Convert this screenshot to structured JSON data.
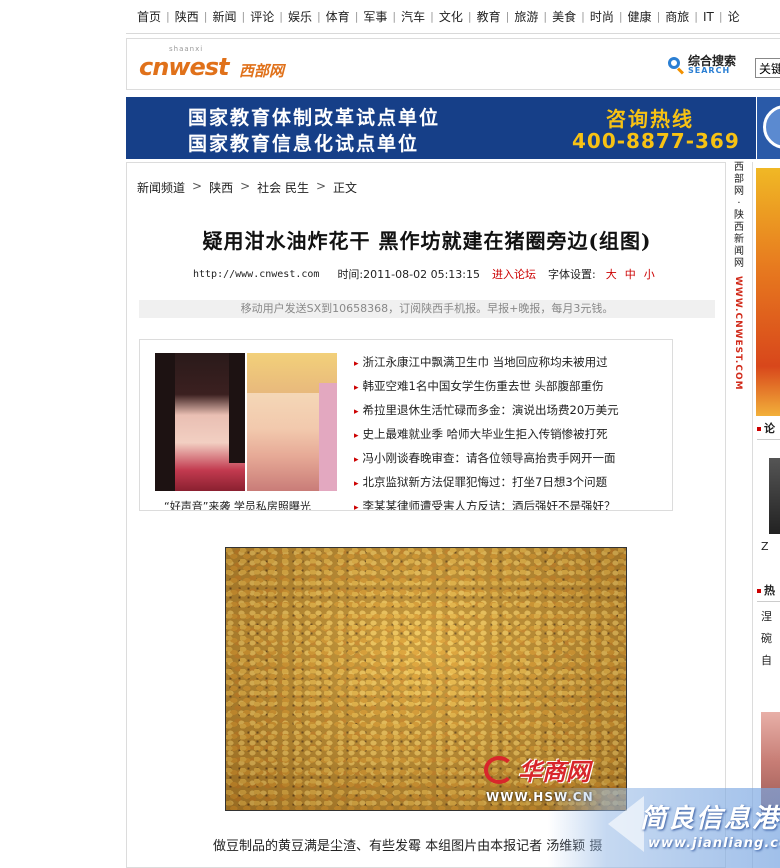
{
  "nav": {
    "items": [
      "首页",
      "陕西",
      "新闻",
      "评论",
      "娱乐",
      "体育",
      "军事",
      "汽车",
      "文化",
      "教育",
      "旅游",
      "美食",
      "时尚",
      "健康",
      "商旅",
      "IT",
      "论"
    ]
  },
  "logo": {
    "text": "cnwest",
    "sub": "shaanxi",
    "name": "西部网"
  },
  "search": {
    "label": "综合搜索",
    "label_en": "SEARCH",
    "input_value": "关键"
  },
  "banner": {
    "line1": "国家教育体制改革试点单位",
    "line2": "国家教育信息化试点单位",
    "hotline_label": "咨询热线",
    "hotline_phone": "400-8877-369"
  },
  "breadcrumb": {
    "items": [
      "新闻频道",
      "陕西",
      "社会 民生",
      "正文"
    ]
  },
  "article": {
    "title": "疑用泔水油炸花干 黑作坊就建在猪圈旁边(组图)",
    "url": "http://www.cnwest.com",
    "time": "时间:2011-08-02 05:13:15",
    "forum_link": "进入论坛",
    "font_label": "字体设置:",
    "font_sizes": [
      "大",
      "中",
      "小"
    ],
    "promo": "移动用户发送SX到10658368，订阅陕西手机报。早报+晚报，每月3元钱。",
    "image_watermark": "华商网",
    "image_watermark_url": "WWW.HSW.CN",
    "caption": "做豆制品的黄豆满是尘渣、有些发霉 本组图片由本报记者 汤维颖 摄"
  },
  "feature": {
    "photo_caption": "“好声音”来袭 学员私房照曝光",
    "news": [
      "浙江永康江中飘满卫生巾 当地回应称均未被用过",
      "韩亚空难1名中国女学生伤重去世 头部腹部重伤",
      "希拉里退休生活忙碌而多金：演说出场费20万美元",
      "史上最难就业季 哈师大毕业生拒入传销惨被打死",
      "冯小刚谈春晚审查：请各位领导高抬贵手网开一面",
      "北京监狱新方法促罪犯悔过：打坐7日想3个问题",
      "李某某律师遭受害人方反诘：酒后强奸不是强奸？"
    ]
  },
  "vertical": {
    "text": [
      "西",
      "部",
      "网",
      "·",
      "陕",
      "西",
      "新",
      "闻",
      "网"
    ],
    "url": "WWW.CNWEST.COM"
  },
  "sidebar": {
    "sections": [
      "论",
      "热"
    ],
    "items": [
      "涅",
      "碗",
      "自"
    ],
    "snippet": "Z"
  },
  "site_mark": {
    "title": "简良信息港",
    "url": "www.jianliang.com"
  }
}
